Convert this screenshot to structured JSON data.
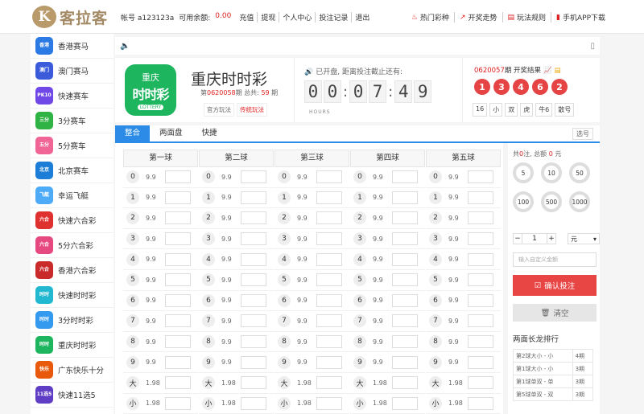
{
  "header": {
    "logo_mark": "K",
    "logo_text": "客拉客",
    "account_label": "帐号 a123123a",
    "balance_label": "可用余额:",
    "balance_value": "0.00",
    "links": [
      "充值",
      "提现",
      "个人中心",
      "投注记录",
      "退出"
    ],
    "right_links": [
      {
        "icon": "fire-icon",
        "label": "热门彩种"
      },
      {
        "icon": "trend-icon",
        "label": "开奖走势"
      },
      {
        "icon": "rules-icon",
        "label": "玩法规则"
      },
      {
        "icon": "mobile-icon",
        "label": "手机APP下载"
      }
    ]
  },
  "sidebar": {
    "items": [
      {
        "label": "香港赛马",
        "icon_text": "香港",
        "color": "#2c7be5"
      },
      {
        "label": "澳门赛马",
        "icon_text": "澳门",
        "color": "#3b5bdb"
      },
      {
        "label": "快速赛车",
        "icon_text": "PK10",
        "color": "#7048e8"
      },
      {
        "label": "3分赛车",
        "icon_text": "三分",
        "color": "#2fb344"
      },
      {
        "label": "5分赛车",
        "icon_text": "五分",
        "color": "#f06595"
      },
      {
        "label": "北京赛车",
        "icon_text": "北京",
        "color": "#1c7ed6"
      },
      {
        "label": "幸运飞艇",
        "icon_text": "飞艇",
        "color": "#4dabf7"
      },
      {
        "label": "快速六合彩",
        "icon_text": "六合",
        "color": "#e03131"
      },
      {
        "label": "5分六合彩",
        "icon_text": "六合",
        "color": "#e64980"
      },
      {
        "label": "香港六合彩",
        "icon_text": "六合",
        "color": "#c92a2a"
      },
      {
        "label": "快速时时彩",
        "icon_text": "时时",
        "color": "#22b8cf"
      },
      {
        "label": "3分时时彩",
        "icon_text": "时时",
        "color": "#339af0"
      },
      {
        "label": "重庆时时彩",
        "icon_text": "时时",
        "color": "#1db55e"
      },
      {
        "label": "广东快乐十分",
        "icon_text": "快乐",
        "color": "#e8590c"
      },
      {
        "label": "快速11选5",
        "icon_text": "11选5",
        "color": "#5f3dc4"
      }
    ]
  },
  "game": {
    "icon_top": "重庆",
    "icon_main": "时时彩",
    "icon_sub": "LOTTERY",
    "name": "重庆时时彩",
    "issue_prefix": "第",
    "issue_no": "0620058",
    "issue_suffix": "期 总共:",
    "total": "59",
    "total_suffix": "期",
    "mode_official": "官方玩法",
    "mode_traditional": "传统玩法"
  },
  "countdown": {
    "text": "已开盘, 距离投注截止还有:",
    "digits": [
      "0",
      "0",
      "0",
      "7",
      "4",
      "9"
    ],
    "hours_label": "HOURS"
  },
  "result": {
    "issue": "0620057",
    "title_suffix": "期 开奖结果",
    "balls": [
      "1",
      "3",
      "4",
      "6",
      "2"
    ],
    "tags": [
      "16",
      "小",
      "双",
      "虎",
      "牛6",
      "散号"
    ]
  },
  "tabs": [
    "整合",
    "两面盘",
    "快捷"
  ],
  "tab_right": "选号",
  "notice_right": "▯",
  "bet": {
    "columns": [
      "第一球",
      "第二球",
      "第三球",
      "第四球",
      "第五球"
    ],
    "rows": [
      {
        "num": "0",
        "odds": "9.9"
      },
      {
        "num": "1",
        "odds": "9.9"
      },
      {
        "num": "2",
        "odds": "9.9"
      },
      {
        "num": "3",
        "odds": "9.9"
      },
      {
        "num": "4",
        "odds": "9.9"
      },
      {
        "num": "5",
        "odds": "9.9"
      },
      {
        "num": "6",
        "odds": "9.9"
      },
      {
        "num": "7",
        "odds": "9.9"
      },
      {
        "num": "8",
        "odds": "9.9"
      },
      {
        "num": "9",
        "odds": "9.9"
      },
      {
        "num": "大",
        "odds": "1.98"
      },
      {
        "num": "小",
        "odds": "1.98"
      }
    ]
  },
  "panel": {
    "count_prefix": "共",
    "count": "0",
    "count_mid": "注, 总额",
    "total": "0",
    "total_suffix": "元",
    "chips": [
      "5",
      "10",
      "50",
      "100",
      "500",
      "1000"
    ],
    "stepper_value": "1",
    "unit": "元",
    "amount_placeholder": "输入自定义金额",
    "confirm_label": "确认投注",
    "clear_label": "清空",
    "long_title": "两面长龙排行",
    "long_rows": [
      {
        "name": "第2球大小 - 小",
        "count": "4期"
      },
      {
        "name": "第1球大小 - 小",
        "count": "3期"
      },
      {
        "name": "第1球单双 - 单",
        "count": "3期"
      },
      {
        "name": "第5球单双 - 双",
        "count": "3期"
      }
    ]
  }
}
